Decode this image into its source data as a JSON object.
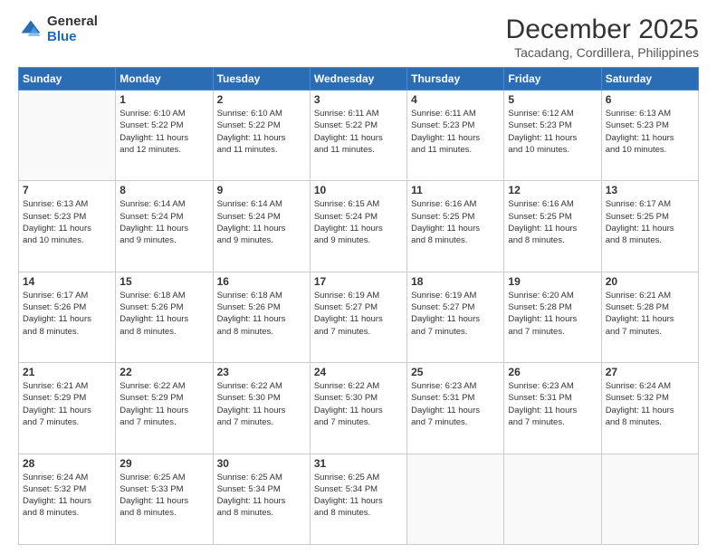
{
  "logo": {
    "general": "General",
    "blue": "Blue"
  },
  "title": "December 2025",
  "subtitle": "Tacadang, Cordillera, Philippines",
  "days_header": [
    "Sunday",
    "Monday",
    "Tuesday",
    "Wednesday",
    "Thursday",
    "Friday",
    "Saturday"
  ],
  "weeks": [
    [
      {
        "day": "",
        "info": ""
      },
      {
        "day": "1",
        "info": "Sunrise: 6:10 AM\nSunset: 5:22 PM\nDaylight: 11 hours\nand 12 minutes."
      },
      {
        "day": "2",
        "info": "Sunrise: 6:10 AM\nSunset: 5:22 PM\nDaylight: 11 hours\nand 11 minutes."
      },
      {
        "day": "3",
        "info": "Sunrise: 6:11 AM\nSunset: 5:22 PM\nDaylight: 11 hours\nand 11 minutes."
      },
      {
        "day": "4",
        "info": "Sunrise: 6:11 AM\nSunset: 5:23 PM\nDaylight: 11 hours\nand 11 minutes."
      },
      {
        "day": "5",
        "info": "Sunrise: 6:12 AM\nSunset: 5:23 PM\nDaylight: 11 hours\nand 10 minutes."
      },
      {
        "day": "6",
        "info": "Sunrise: 6:13 AM\nSunset: 5:23 PM\nDaylight: 11 hours\nand 10 minutes."
      }
    ],
    [
      {
        "day": "7",
        "info": "Sunrise: 6:13 AM\nSunset: 5:23 PM\nDaylight: 11 hours\nand 10 minutes."
      },
      {
        "day": "8",
        "info": "Sunrise: 6:14 AM\nSunset: 5:24 PM\nDaylight: 11 hours\nand 9 minutes."
      },
      {
        "day": "9",
        "info": "Sunrise: 6:14 AM\nSunset: 5:24 PM\nDaylight: 11 hours\nand 9 minutes."
      },
      {
        "day": "10",
        "info": "Sunrise: 6:15 AM\nSunset: 5:24 PM\nDaylight: 11 hours\nand 9 minutes."
      },
      {
        "day": "11",
        "info": "Sunrise: 6:16 AM\nSunset: 5:25 PM\nDaylight: 11 hours\nand 8 minutes."
      },
      {
        "day": "12",
        "info": "Sunrise: 6:16 AM\nSunset: 5:25 PM\nDaylight: 11 hours\nand 8 minutes."
      },
      {
        "day": "13",
        "info": "Sunrise: 6:17 AM\nSunset: 5:25 PM\nDaylight: 11 hours\nand 8 minutes."
      }
    ],
    [
      {
        "day": "14",
        "info": "Sunrise: 6:17 AM\nSunset: 5:26 PM\nDaylight: 11 hours\nand 8 minutes."
      },
      {
        "day": "15",
        "info": "Sunrise: 6:18 AM\nSunset: 5:26 PM\nDaylight: 11 hours\nand 8 minutes."
      },
      {
        "day": "16",
        "info": "Sunrise: 6:18 AM\nSunset: 5:26 PM\nDaylight: 11 hours\nand 8 minutes."
      },
      {
        "day": "17",
        "info": "Sunrise: 6:19 AM\nSunset: 5:27 PM\nDaylight: 11 hours\nand 7 minutes."
      },
      {
        "day": "18",
        "info": "Sunrise: 6:19 AM\nSunset: 5:27 PM\nDaylight: 11 hours\nand 7 minutes."
      },
      {
        "day": "19",
        "info": "Sunrise: 6:20 AM\nSunset: 5:28 PM\nDaylight: 11 hours\nand 7 minutes."
      },
      {
        "day": "20",
        "info": "Sunrise: 6:21 AM\nSunset: 5:28 PM\nDaylight: 11 hours\nand 7 minutes."
      }
    ],
    [
      {
        "day": "21",
        "info": "Sunrise: 6:21 AM\nSunset: 5:29 PM\nDaylight: 11 hours\nand 7 minutes."
      },
      {
        "day": "22",
        "info": "Sunrise: 6:22 AM\nSunset: 5:29 PM\nDaylight: 11 hours\nand 7 minutes."
      },
      {
        "day": "23",
        "info": "Sunrise: 6:22 AM\nSunset: 5:30 PM\nDaylight: 11 hours\nand 7 minutes."
      },
      {
        "day": "24",
        "info": "Sunrise: 6:22 AM\nSunset: 5:30 PM\nDaylight: 11 hours\nand 7 minutes."
      },
      {
        "day": "25",
        "info": "Sunrise: 6:23 AM\nSunset: 5:31 PM\nDaylight: 11 hours\nand 7 minutes."
      },
      {
        "day": "26",
        "info": "Sunrise: 6:23 AM\nSunset: 5:31 PM\nDaylight: 11 hours\nand 7 minutes."
      },
      {
        "day": "27",
        "info": "Sunrise: 6:24 AM\nSunset: 5:32 PM\nDaylight: 11 hours\nand 8 minutes."
      }
    ],
    [
      {
        "day": "28",
        "info": "Sunrise: 6:24 AM\nSunset: 5:32 PM\nDaylight: 11 hours\nand 8 minutes."
      },
      {
        "day": "29",
        "info": "Sunrise: 6:25 AM\nSunset: 5:33 PM\nDaylight: 11 hours\nand 8 minutes."
      },
      {
        "day": "30",
        "info": "Sunrise: 6:25 AM\nSunset: 5:34 PM\nDaylight: 11 hours\nand 8 minutes."
      },
      {
        "day": "31",
        "info": "Sunrise: 6:25 AM\nSunset: 5:34 PM\nDaylight: 11 hours\nand 8 minutes."
      },
      {
        "day": "",
        "info": ""
      },
      {
        "day": "",
        "info": ""
      },
      {
        "day": "",
        "info": ""
      }
    ]
  ]
}
